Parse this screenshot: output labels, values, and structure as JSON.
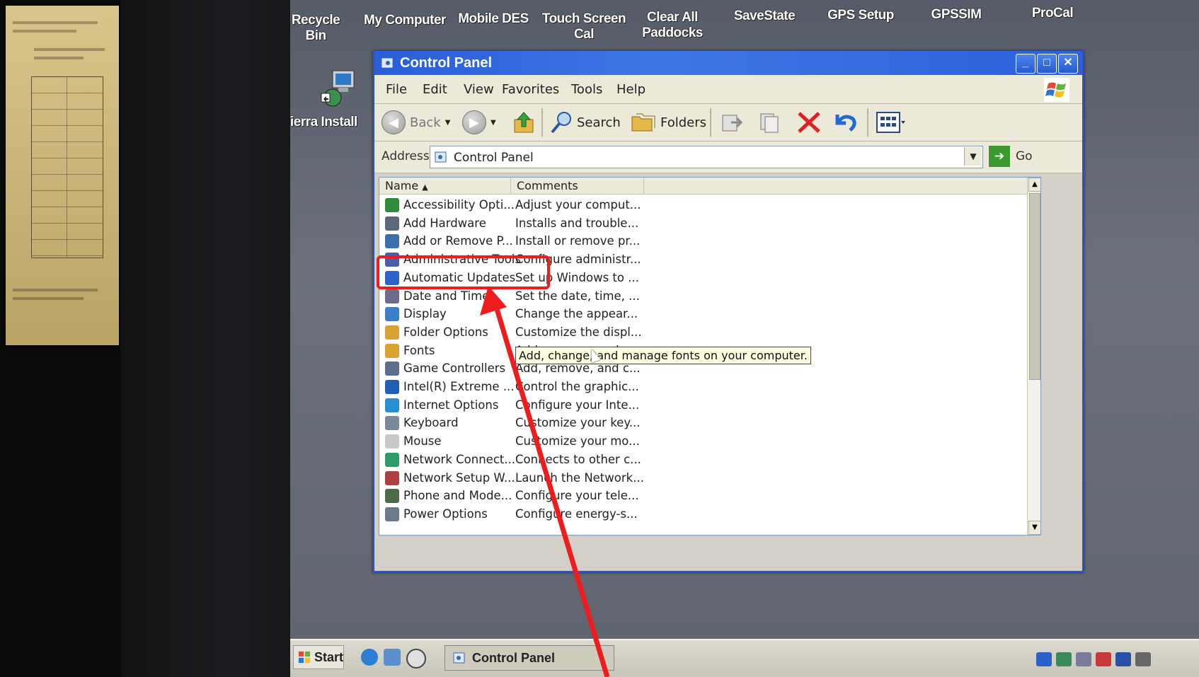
{
  "desktop": {
    "icons": [
      {
        "label": "Recycle Bin"
      },
      {
        "label": "My Computer"
      },
      {
        "label": "Mobile DES"
      },
      {
        "label": "Touch Screen\nCal"
      },
      {
        "label": "Clear All\nPaddocks"
      },
      {
        "label": "SaveState"
      },
      {
        "label": "GPS Setup"
      },
      {
        "label": "GPSSIM"
      },
      {
        "label": "ProCal"
      },
      {
        "label": "Tierra Install"
      }
    ]
  },
  "window": {
    "title": "Control Panel",
    "menu": [
      "File",
      "Edit",
      "View",
      "Favorites",
      "Tools",
      "Help"
    ],
    "toolbar": {
      "back": "Back",
      "search": "Search",
      "folders": "Folders"
    },
    "address": {
      "label": "Address",
      "value": "Control Panel",
      "go": "Go"
    },
    "columns": {
      "name": "Name",
      "comments": "Comments"
    },
    "items": [
      {
        "name": "Accessibility Opti...",
        "comment": "Adjust your comput...",
        "icon": "accessibility-icon",
        "color": "#2e8b3a"
      },
      {
        "name": "Add Hardware",
        "comment": "Installs and trouble...",
        "icon": "hardware-icon",
        "color": "#5a6a7a"
      },
      {
        "name": "Add or Remove P...",
        "comment": "Install or remove pr...",
        "icon": "programs-icon",
        "color": "#3a6fb0"
      },
      {
        "name": "Administrative Tools",
        "comment": "Configure administr...",
        "icon": "admin-tools-icon",
        "color": "#4a5ea8"
      },
      {
        "name": "Automatic Updates",
        "comment": "Set up Windows to ...",
        "icon": "updates-icon",
        "color": "#2f62c8"
      },
      {
        "name": "Date and Time",
        "comment": "Set the date, time, ...",
        "icon": "clock-icon",
        "color": "#6b6b8a"
      },
      {
        "name": "Display",
        "comment": "Change the appear...",
        "icon": "display-icon",
        "color": "#3b7fc4"
      },
      {
        "name": "Folder Options",
        "comment": "Customize the displ...",
        "icon": "folder-icon",
        "color": "#d8a330"
      },
      {
        "name": "Fonts",
        "comment": "Add, remove, and c...",
        "icon": "fonts-icon",
        "color": "#d8a330"
      },
      {
        "name": "Game Controllers",
        "comment": "Add, remove, and c...",
        "icon": "gamepad-icon",
        "color": "#5c6f8a"
      },
      {
        "name": "Intel(R) Extreme ...",
        "comment": "Control the graphic...",
        "icon": "intel-icon",
        "color": "#1f5fb6"
      },
      {
        "name": "Internet Options",
        "comment": "Configure your Inte...",
        "icon": "internet-icon",
        "color": "#2a8fd0"
      },
      {
        "name": "Keyboard",
        "comment": "Customize your key...",
        "icon": "keyboard-icon",
        "color": "#7a8a9a"
      },
      {
        "name": "Mouse",
        "comment": "Customize your mo...",
        "icon": "mouse-icon",
        "color": "#c8c8c8"
      },
      {
        "name": "Network Connect...",
        "comment": "Connects to other c...",
        "icon": "network-icon",
        "color": "#2f9a6a"
      },
      {
        "name": "Network Setup W...",
        "comment": "Launch the Network...",
        "icon": "network-setup-icon",
        "color": "#b04040"
      },
      {
        "name": "Phone and Mode...",
        "comment": "Configure your tele...",
        "icon": "phone-icon",
        "color": "#4a6a4a"
      },
      {
        "name": "Power Options",
        "comment": "Configure energy-s...",
        "icon": "power-icon",
        "color": "#6a7a8a"
      }
    ],
    "tooltip": "Add, change, and manage fonts on your computer."
  },
  "taskbar": {
    "start": "Start",
    "task": "Control Panel"
  },
  "annotation": {
    "color": "#ee1c1c",
    "highlighted_item": "Administrative Tools"
  }
}
